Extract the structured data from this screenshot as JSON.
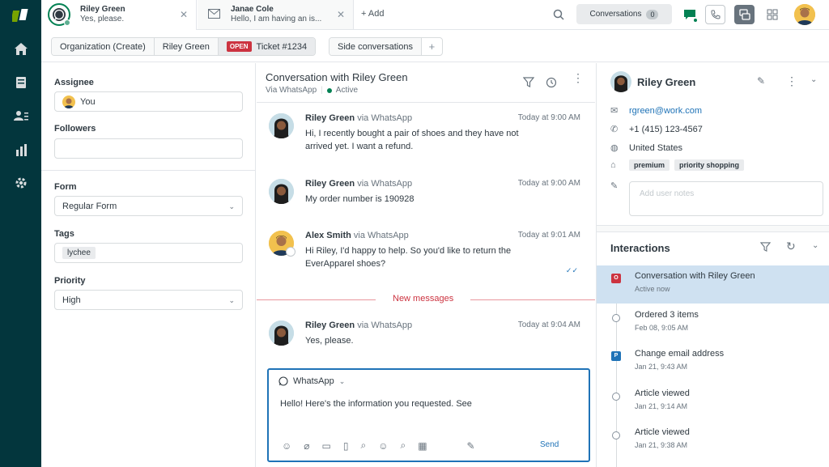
{
  "tabs": [
    {
      "title": "Riley Green",
      "subtitle": "Yes, please."
    },
    {
      "title": "Janae Cole",
      "subtitle": "Hello, I am having an is..."
    }
  ],
  "add_tab_label": "+ Add",
  "conversations_button": {
    "label": "Conversations",
    "count": "0"
  },
  "breadcrumb": {
    "org": "Organization (Create)",
    "user": "Riley Green",
    "status": "OPEN",
    "ticket": "Ticket #1234"
  },
  "side_conversations_label": "Side conversations",
  "left_panel": {
    "assignee_label": "Assignee",
    "assignee_value": "You",
    "followers_label": "Followers",
    "form_label": "Form",
    "form_value": "Regular Form",
    "tags_label": "Tags",
    "tag_value": "lychee",
    "priority_label": "Priority",
    "priority_value": "High"
  },
  "conversation": {
    "title": "Conversation with Riley Green",
    "channel": "Via WhatsApp",
    "status": "Active",
    "messages": [
      {
        "author": "Riley Green",
        "via": "via WhatsApp",
        "time": "Today at 9:00 AM",
        "text": "Hi, I recently bought a pair of shoes and they have not arrived yet. I want a refund."
      },
      {
        "author": "Riley Green",
        "via": "via WhatsApp",
        "time": "Today at 9:00 AM",
        "text": "My order number is 190928"
      },
      {
        "author": "Alex Smith",
        "via": "via WhatsApp",
        "time": "Today at 9:01 AM",
        "text": "Hi Riley, I'd happy to help. So you'd like to return the EverApparel shoes?"
      },
      {
        "author": "Riley Green",
        "via": "via WhatsApp",
        "time": "Today at 9:04 AM",
        "text": "Yes, please."
      }
    ],
    "new_messages_label": "New messages"
  },
  "composer": {
    "channel": "WhatsApp",
    "draft": "Hello! Here's the information you requested. See",
    "send_label": "Send"
  },
  "customer": {
    "name": "Riley Green",
    "email": "rgreen@work.com",
    "phone": "+1 (415) 123-4567",
    "location": "United States",
    "tags": [
      "premium",
      "priority shopping"
    ],
    "notes_placeholder": "Add user notes"
  },
  "interactions": {
    "title": "Interactions",
    "items": [
      {
        "title": "Conversation with Riley Green",
        "sub": "Active now",
        "marker": "O"
      },
      {
        "title": "Ordered 3 items",
        "sub": "Feb 08, 9:05 AM",
        "marker": ""
      },
      {
        "title": "Change email address",
        "sub": "Jan 21, 9:43 AM",
        "marker": "P"
      },
      {
        "title": "Article viewed",
        "sub": "Jan 21, 9:14 AM",
        "marker": ""
      },
      {
        "title": "Article viewed",
        "sub": "Jan 21, 9:38 AM",
        "marker": ""
      }
    ]
  },
  "colors": {
    "nav_bg": "#03363d",
    "accent_blue": "#1f73b7",
    "open_red": "#cc3340",
    "active_green": "#038153",
    "selected_row": "#cfe1f1"
  },
  "icons": [
    "logo-icon",
    "home-icon",
    "tickets-icon",
    "users-icon",
    "reports-icon",
    "settings-icon",
    "whatsapp-icon",
    "mail-icon",
    "search-icon",
    "chat-icon",
    "phone-icon",
    "side-panel-icon",
    "apps-grid-icon",
    "filter-icon",
    "history-icon",
    "more-icon",
    "pencil-icon",
    "chevron-down-icon",
    "globe-icon",
    "tag-icon",
    "note-icon",
    "refresh-icon",
    "emoji-icon",
    "attach-icon",
    "macro-icon",
    "doc-icon",
    "table-icon",
    "read-receipt-icon"
  ]
}
